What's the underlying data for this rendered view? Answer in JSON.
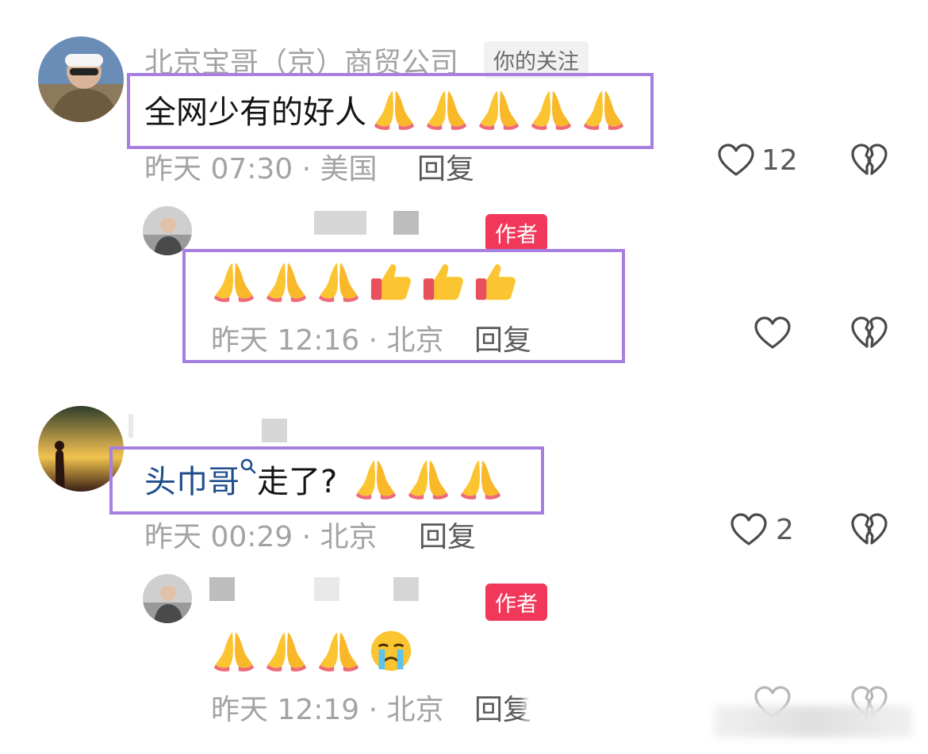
{
  "comments": [
    {
      "username": "北京宝哥（京）商贸公司",
      "follow_tag": "你的关注",
      "text": "全网少有的好人",
      "time": "昨天 07:30 · 美国",
      "reply_label": "回复",
      "like_count": "12",
      "emojis": [
        "folded-hands",
        "folded-hands",
        "folded-hands",
        "folded-hands",
        "folded-hands"
      ],
      "reply": {
        "author_tag": "作者",
        "emojis": [
          "folded-hands",
          "folded-hands",
          "folded-hands",
          "thumbs-up",
          "thumbs-up",
          "thumbs-up"
        ],
        "time": "昨天 12:16 · 北京",
        "reply_label": "回复"
      }
    },
    {
      "link_text": "头巾哥",
      "text": "走了?",
      "time": "昨天 00:29 · 北京",
      "reply_label": "回复",
      "like_count": "2",
      "emojis": [
        "folded-hands",
        "folded-hands",
        "folded-hands"
      ],
      "reply": {
        "author_tag": "作者",
        "emojis": [
          "folded-hands",
          "folded-hands",
          "folded-hands",
          "crying-face"
        ],
        "time": "昨天 12:19 · 北京",
        "reply_label": "回复"
      }
    }
  ],
  "colors": {
    "highlight_box": "#a67fe0",
    "author_tag": "#f2385a",
    "link": "#1f4e8c"
  }
}
